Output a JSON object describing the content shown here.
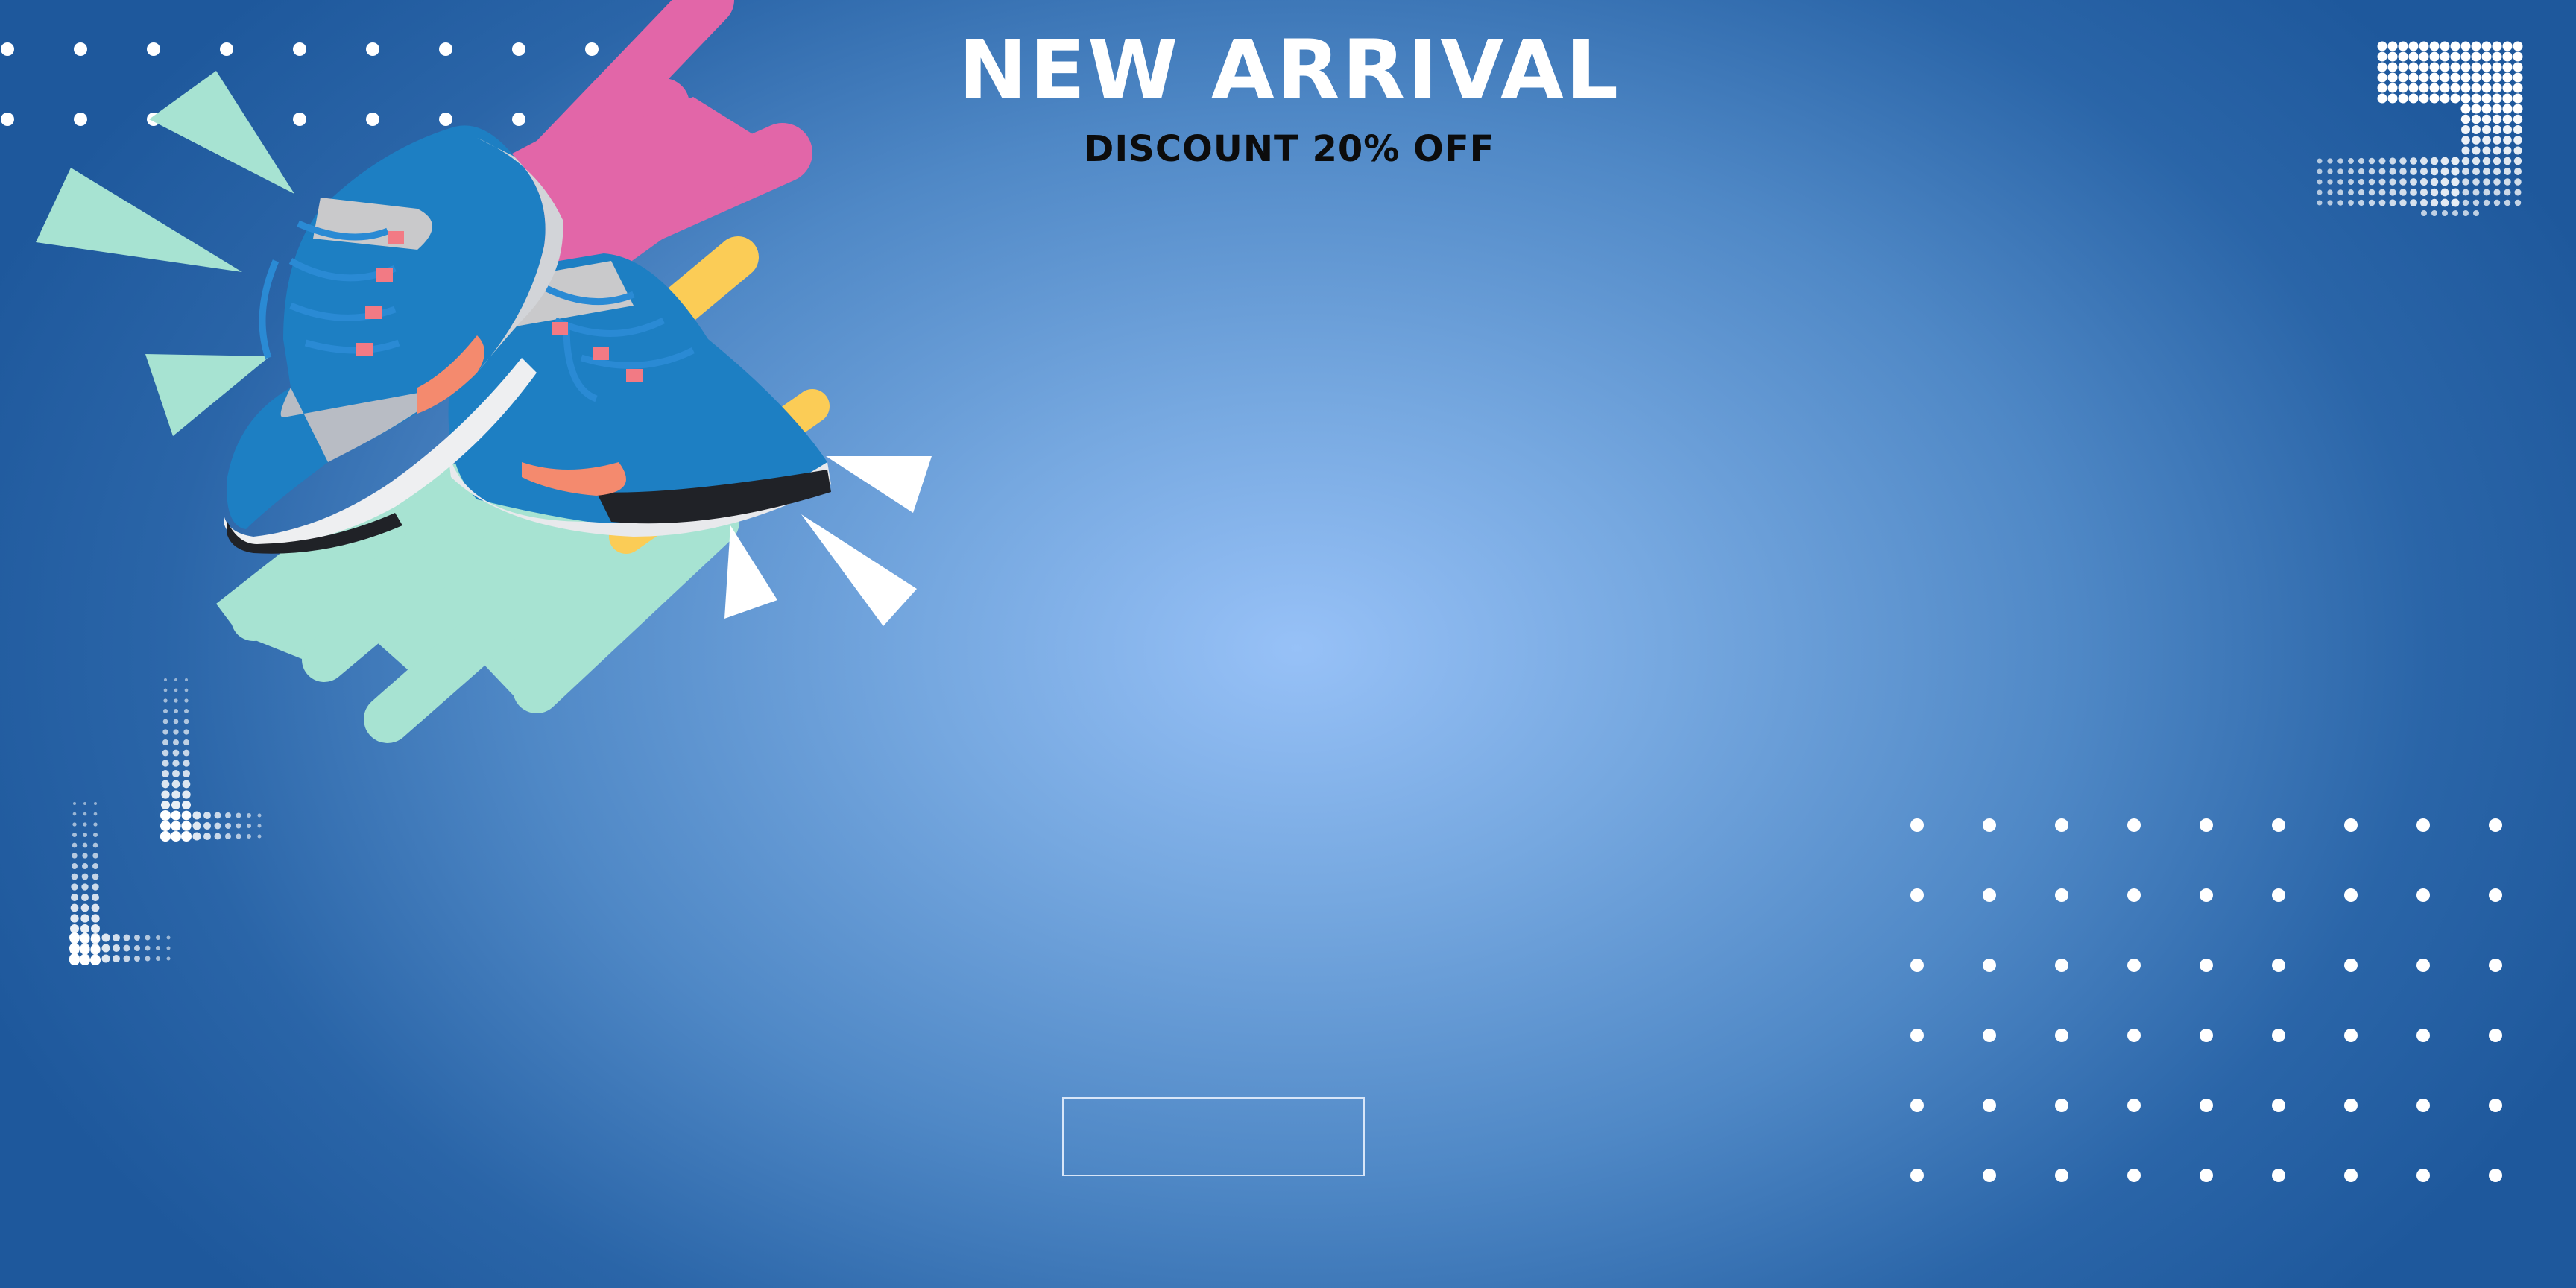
{
  "hero": {
    "title": "NEW ARRIVAL",
    "subtitle": "DISCOUNT 20% OFF",
    "cta_label": ""
  },
  "colors": {
    "bg_center": "#97c1f7",
    "bg_edge": "#1e589c",
    "pink": "#e266a8",
    "yellow": "#fbcc56",
    "mint": "#a7e3d2",
    "shoe_blue": "#1d7fc3",
    "shoe_accent": "#f48a6e"
  },
  "icons": [
    "sneakers-image",
    "dot-grid",
    "halftone-corner",
    "triangle-burst",
    "paint-splash"
  ]
}
